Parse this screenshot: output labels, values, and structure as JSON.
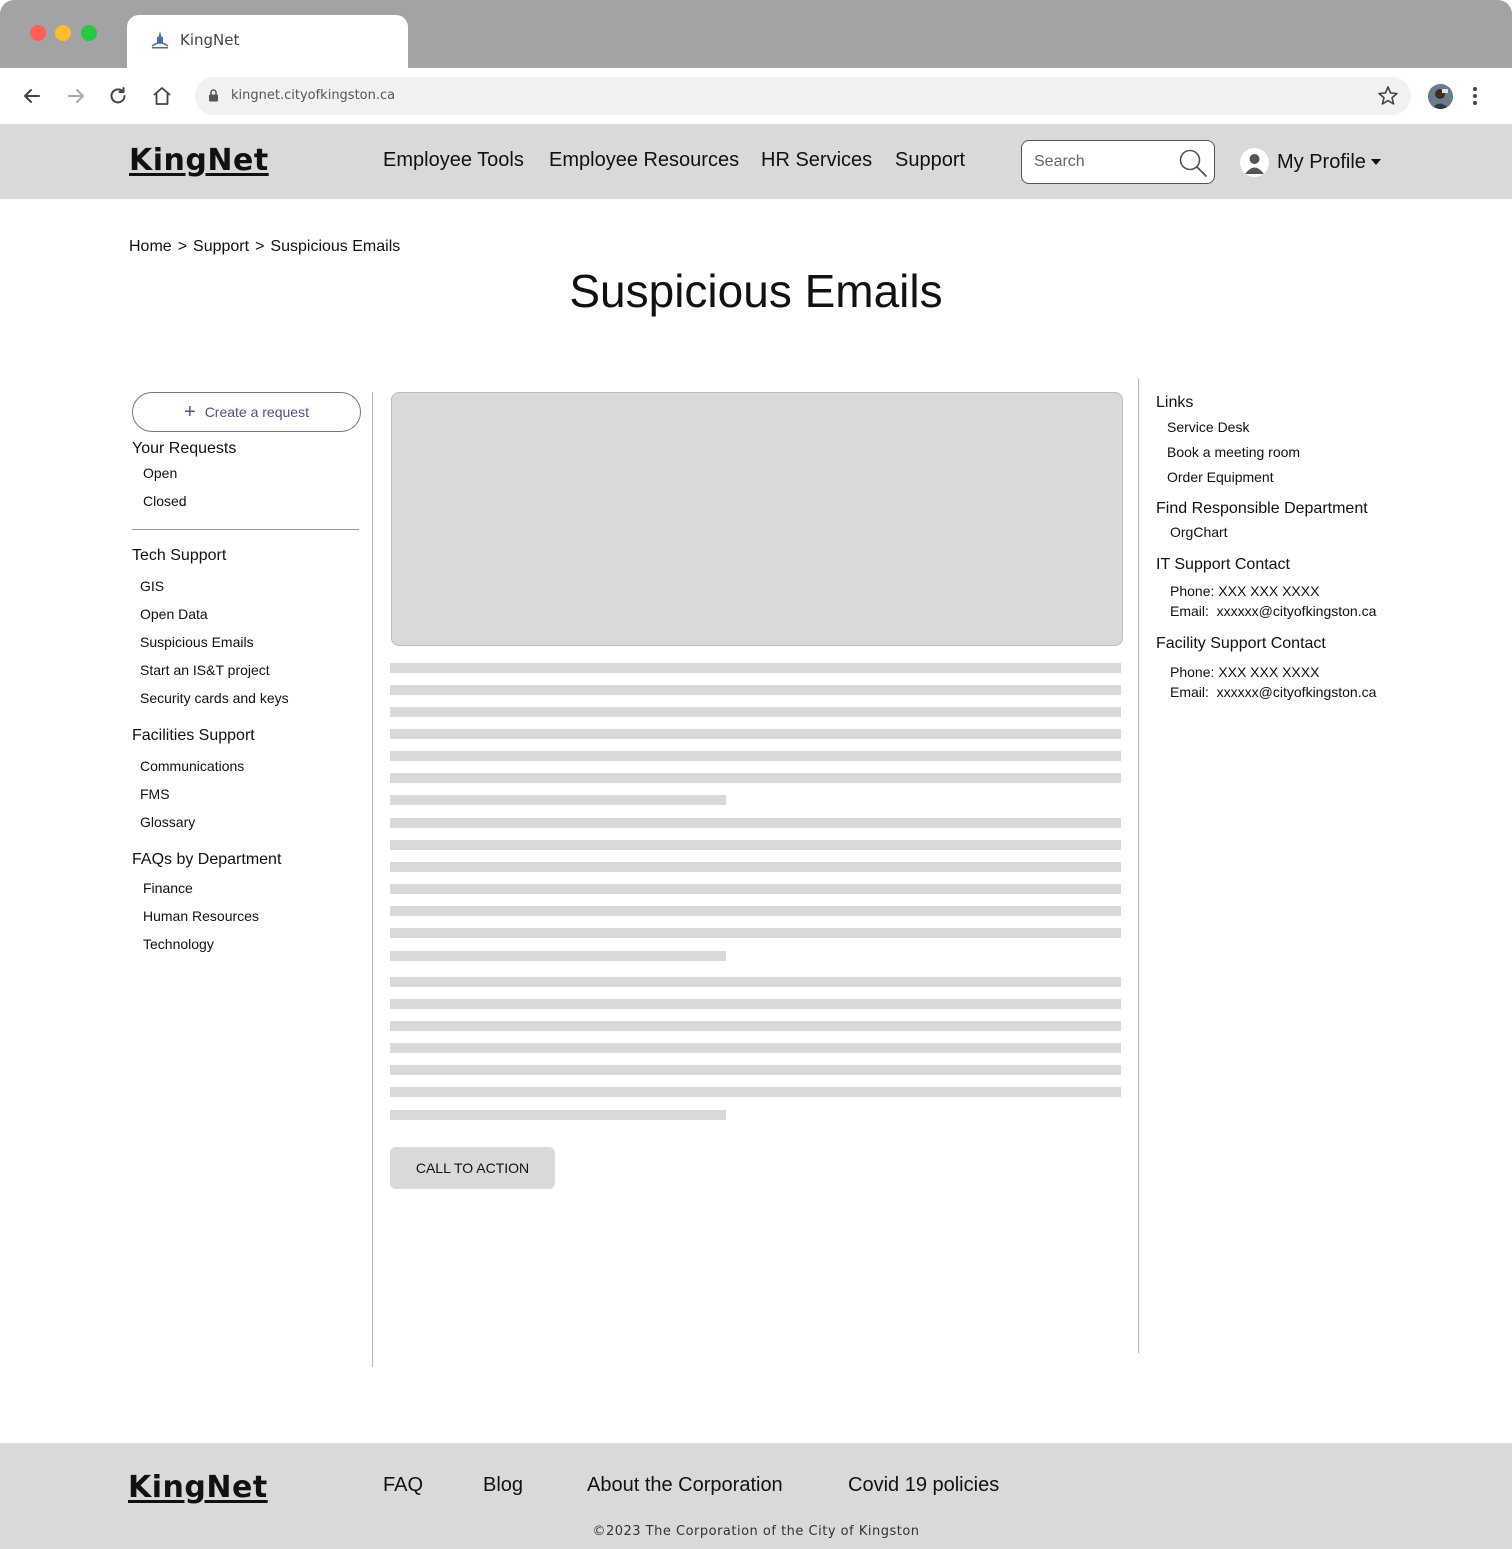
{
  "browser": {
    "tab_title": "KingNet",
    "url": "kingnet.cityofkingston.ca"
  },
  "header": {
    "logo": "KingNet",
    "nav": [
      {
        "label": "Employee Tools"
      },
      {
        "label": "Employee Resources"
      },
      {
        "label": "HR Services"
      },
      {
        "label": "Support"
      }
    ],
    "search_placeholder": "Search",
    "profile_label": "My Profile"
  },
  "breadcrumb": {
    "items": [
      "Home",
      "Support",
      "Suspicious Emails"
    ],
    "separator": ">"
  },
  "page_title": "Suspicious Emails",
  "left_sidebar": {
    "create_label": "Create a request",
    "your_requests": {
      "heading": "Your Requests",
      "items": [
        "Open",
        "Closed"
      ]
    },
    "tech_support": {
      "heading": "Tech Support",
      "items": [
        "GIS",
        "Open Data",
        "Suspicious Emails",
        "Start an IS&T project",
        "Security cards and keys"
      ]
    },
    "facilities_support": {
      "heading": "Facilities Support",
      "items": [
        "Communications",
        "FMS",
        "Glossary"
      ]
    },
    "faqs": {
      "heading": "FAQs by Department",
      "items": [
        "Finance",
        "Human Resources",
        "Technology"
      ]
    }
  },
  "main": {
    "cta_label": "CALL TO ACTION"
  },
  "right_sidebar": {
    "links": {
      "heading": "Links",
      "items": [
        "Service Desk",
        "Book a meeting room",
        "Order Equipment"
      ]
    },
    "responsible": {
      "heading": "Find Responsible Department",
      "items": [
        "OrgChart"
      ]
    },
    "it_contact": {
      "heading": "IT Support Contact",
      "phone": "Phone: XXX XXX XXXX",
      "email": "Email:  xxxxxx@cityofkingston.ca"
    },
    "facility_contact": {
      "heading": "Facility Support Contact",
      "phone": "Phone: XXX XXX XXXX",
      "email": "Email:  xxxxxx@cityofkingston.ca"
    }
  },
  "footer": {
    "logo": "KingNet",
    "links": [
      {
        "label": "FAQ"
      },
      {
        "label": "Blog"
      },
      {
        "label": "About the Corporation"
      },
      {
        "label": "Covid 19 policies"
      }
    ],
    "copyright": "©2023 The Corporation of the City of Kingston"
  }
}
